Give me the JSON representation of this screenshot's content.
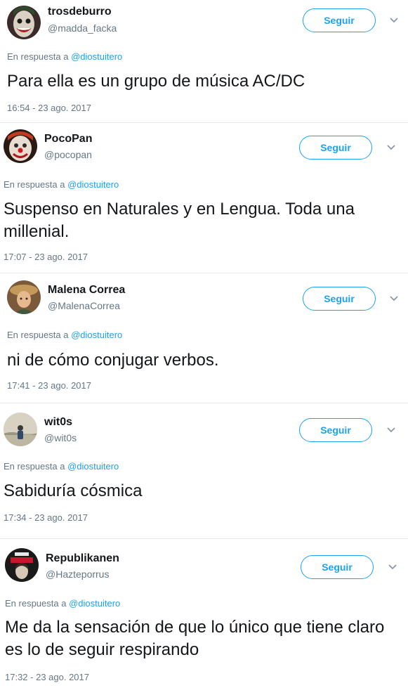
{
  "follow_label": "Seguir",
  "reply_prefix": "En respuesta a",
  "colors": {
    "accent": "#1da1f2",
    "secondary_text": "#657786",
    "primary_text": "#14171a"
  },
  "tweets": [
    {
      "name": "trosdeburro",
      "handle": "@madda_facka",
      "reply_to": "@diostuitero",
      "text": "Para ella es un grupo de música AC/DC",
      "timestamp": "16:54 - 23 ago. 2017",
      "avatar_icon": "joker-face-avatar-icon"
    },
    {
      "name": "PocoPan",
      "handle": "@pocopan",
      "reply_to": "@diostuitero",
      "text": "Suspenso en Naturales y en Lengua. Toda una millenial.",
      "timestamp": "17:07 - 23 ago. 2017",
      "avatar_icon": "clown-face-avatar-icon"
    },
    {
      "name": "Malena Correa",
      "handle": "@MalenaCorrea",
      "reply_to": "@diostuitero",
      "text": "ni de cómo conjugar verbos.",
      "timestamp": "17:41 - 23 ago. 2017",
      "avatar_icon": "woman-hat-avatar-icon"
    },
    {
      "name": "wit0s",
      "handle": "@wit0s",
      "reply_to": "@diostuitero",
      "text": "Sabiduría cósmica",
      "timestamp": "17:34 - 23 ago. 2017",
      "avatar_icon": "person-landscape-avatar-icon"
    },
    {
      "name": "Republikanen",
      "handle": "@Hazteporrus",
      "reply_to": "@diostuitero",
      "text": "Me da la sensación de que lo único que tiene claro es lo de seguir respirando",
      "timestamp": "17:32 - 23 ago. 2017",
      "avatar_icon": "hail-satan-avatar-icon"
    }
  ]
}
